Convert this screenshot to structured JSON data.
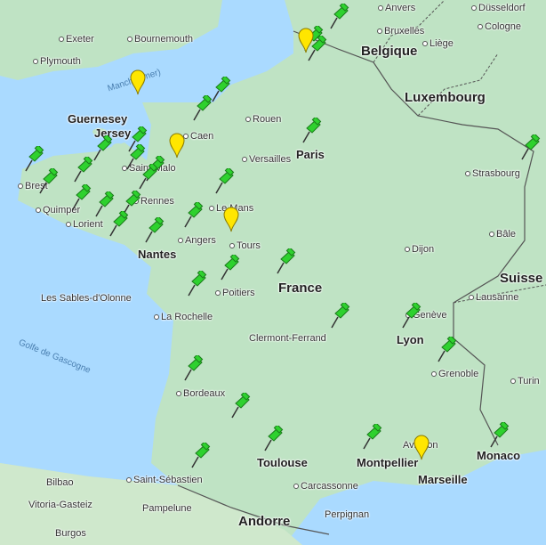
{
  "colors": {
    "land": "#bfe3c4",
    "water": "#aadaff",
    "border": "#555555",
    "pin_green": "#2ed12e",
    "pin_yellow": "#ffe600"
  },
  "countries": [
    "Belgique",
    "Luxembourg",
    "France",
    "Suisse",
    "Monaco",
    "Andorre",
    "Guernesey",
    "Jersey"
  ],
  "seas": [
    "Manche (mer)",
    "Golfe de Gascogne"
  ],
  "cities": [
    "Anvers",
    "Düsseldorf",
    "Exeter",
    "Bournemouth",
    "Bruxelles",
    "Cologne",
    "Plymouth",
    "Liège",
    "Rouen",
    "Caen",
    "Paris",
    "Versailles",
    "Saint-Malo",
    "Strasbourg",
    "Brest",
    "Rennes",
    "Le Mans",
    "Quimper",
    "Lorient",
    "Angers",
    "Tours",
    "Bâle",
    "Nantes",
    "Dijon",
    "Poitiers",
    "Lausanne",
    "Les Sables-d'Olonne",
    "Genève",
    "La Rochelle",
    "Clermont-Ferrand",
    "Lyon",
    "Grenoble",
    "Turin",
    "Bordeaux",
    "Avignon",
    "Toulouse",
    "Montpellier",
    "Marseille",
    "Bilbao",
    "Saint-Sébastien",
    "Carcassonne",
    "Vitoria-Gasteiz",
    "Pampelune",
    "Perpignan",
    "Burgos"
  ],
  "pins": {
    "green_count": 34,
    "yellow_count": 5
  }
}
